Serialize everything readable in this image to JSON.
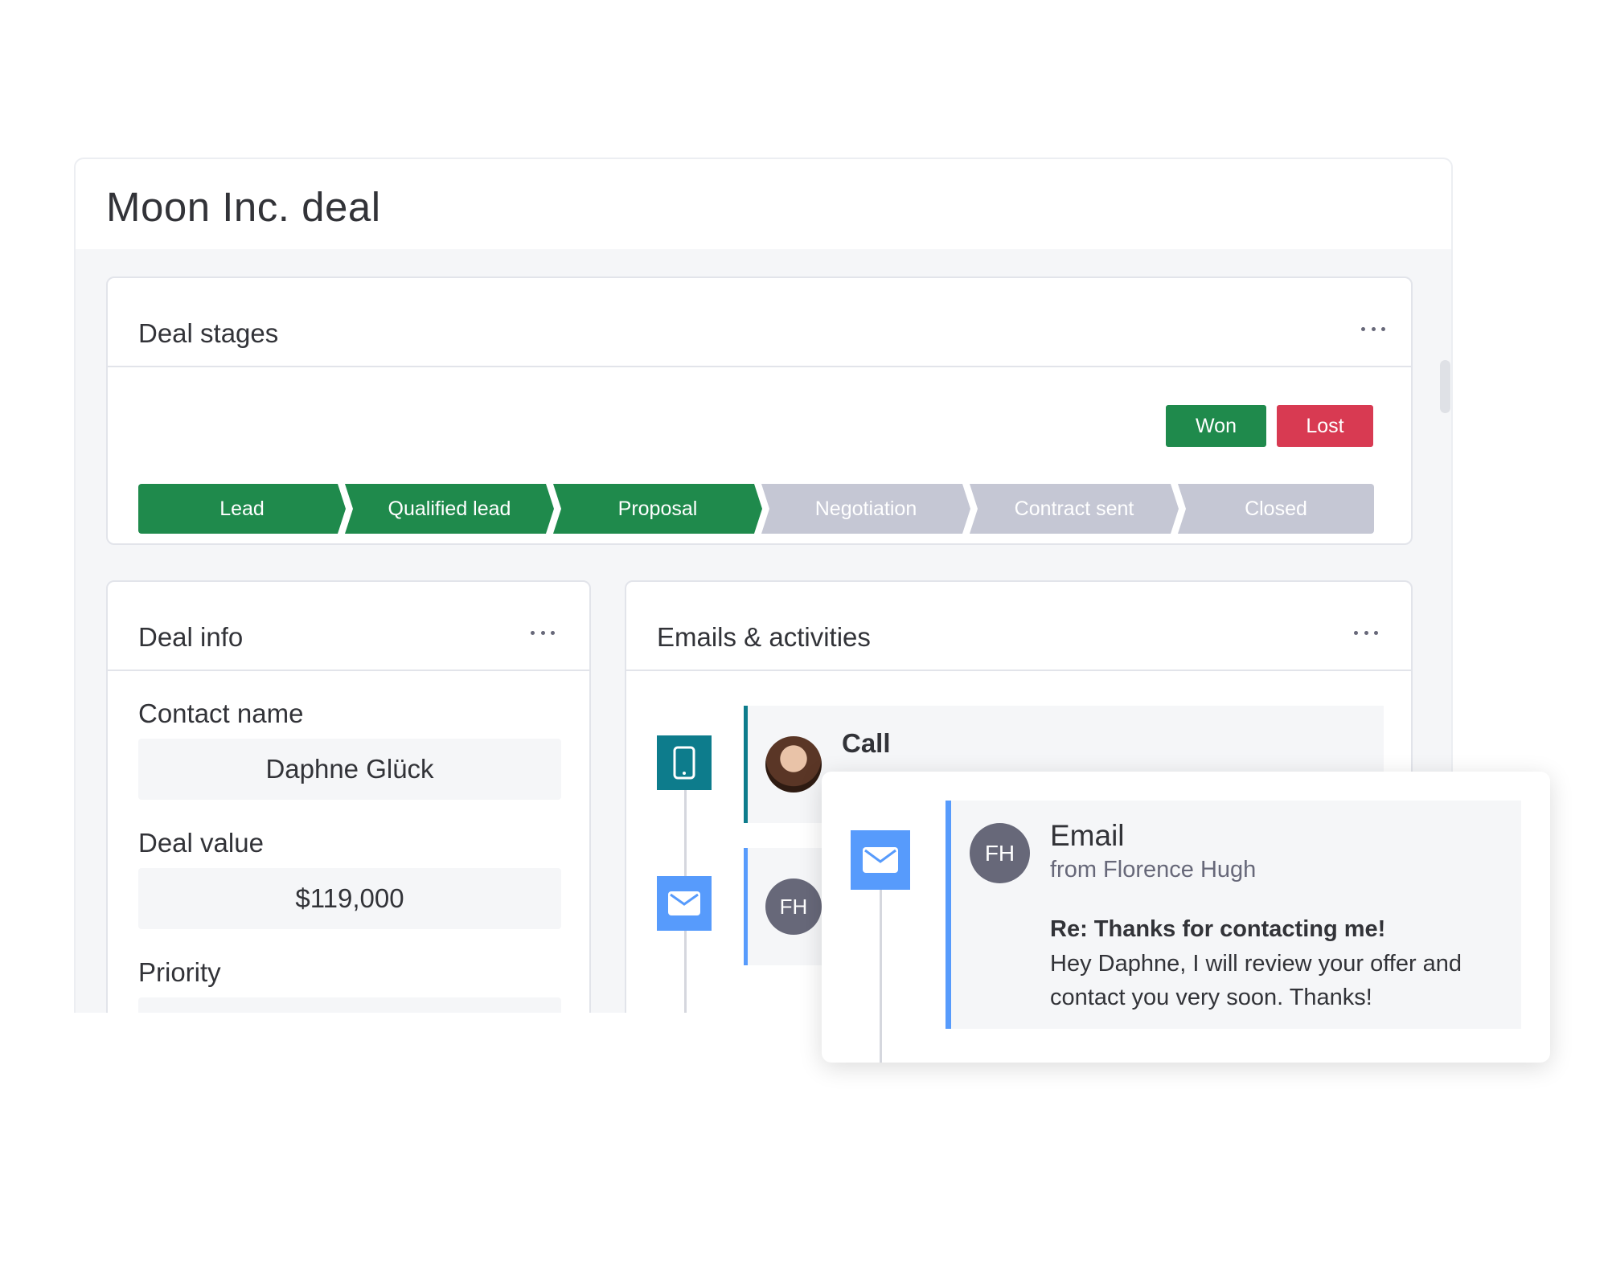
{
  "deal": {
    "title": "Moon Inc. deal"
  },
  "stages_card": {
    "title": "Deal stages",
    "won_label": "Won",
    "lost_label": "Lost",
    "stages": [
      {
        "label": "Lead",
        "status": "done"
      },
      {
        "label": "Qualified lead",
        "status": "done"
      },
      {
        "label": "Proposal",
        "status": "done"
      },
      {
        "label": "Negotiation",
        "status": "todo"
      },
      {
        "label": "Contract sent",
        "status": "todo"
      },
      {
        "label": "Closed",
        "status": "todo"
      }
    ],
    "colors": {
      "done": "#1f8a4c",
      "todo": "#c5c7d4",
      "won": "#1f8a4c",
      "lost": "#d83a52"
    }
  },
  "info_card": {
    "title": "Deal info",
    "contact_name_label": "Contact name",
    "contact_name_value": "Daphne Glück",
    "deal_value_label": "Deal value",
    "deal_value_value": "$119,000",
    "priority_label": "Priority"
  },
  "activities_card": {
    "title": "Emails & activities",
    "items": [
      {
        "type": "call",
        "title": "Call",
        "icon": "phone-icon",
        "accent": "#0d7c8c"
      },
      {
        "type": "email",
        "avatar_initials": "FH",
        "icon": "mail-icon",
        "accent": "#579bfc"
      }
    ]
  },
  "popup": {
    "title": "Email",
    "from": "from Florence Hugh",
    "avatar_initials": "FH",
    "subject": "Re: Thanks for contacting me!",
    "body": "Hey Daphne, I will review your offer and contact you very soon. Thanks!"
  }
}
